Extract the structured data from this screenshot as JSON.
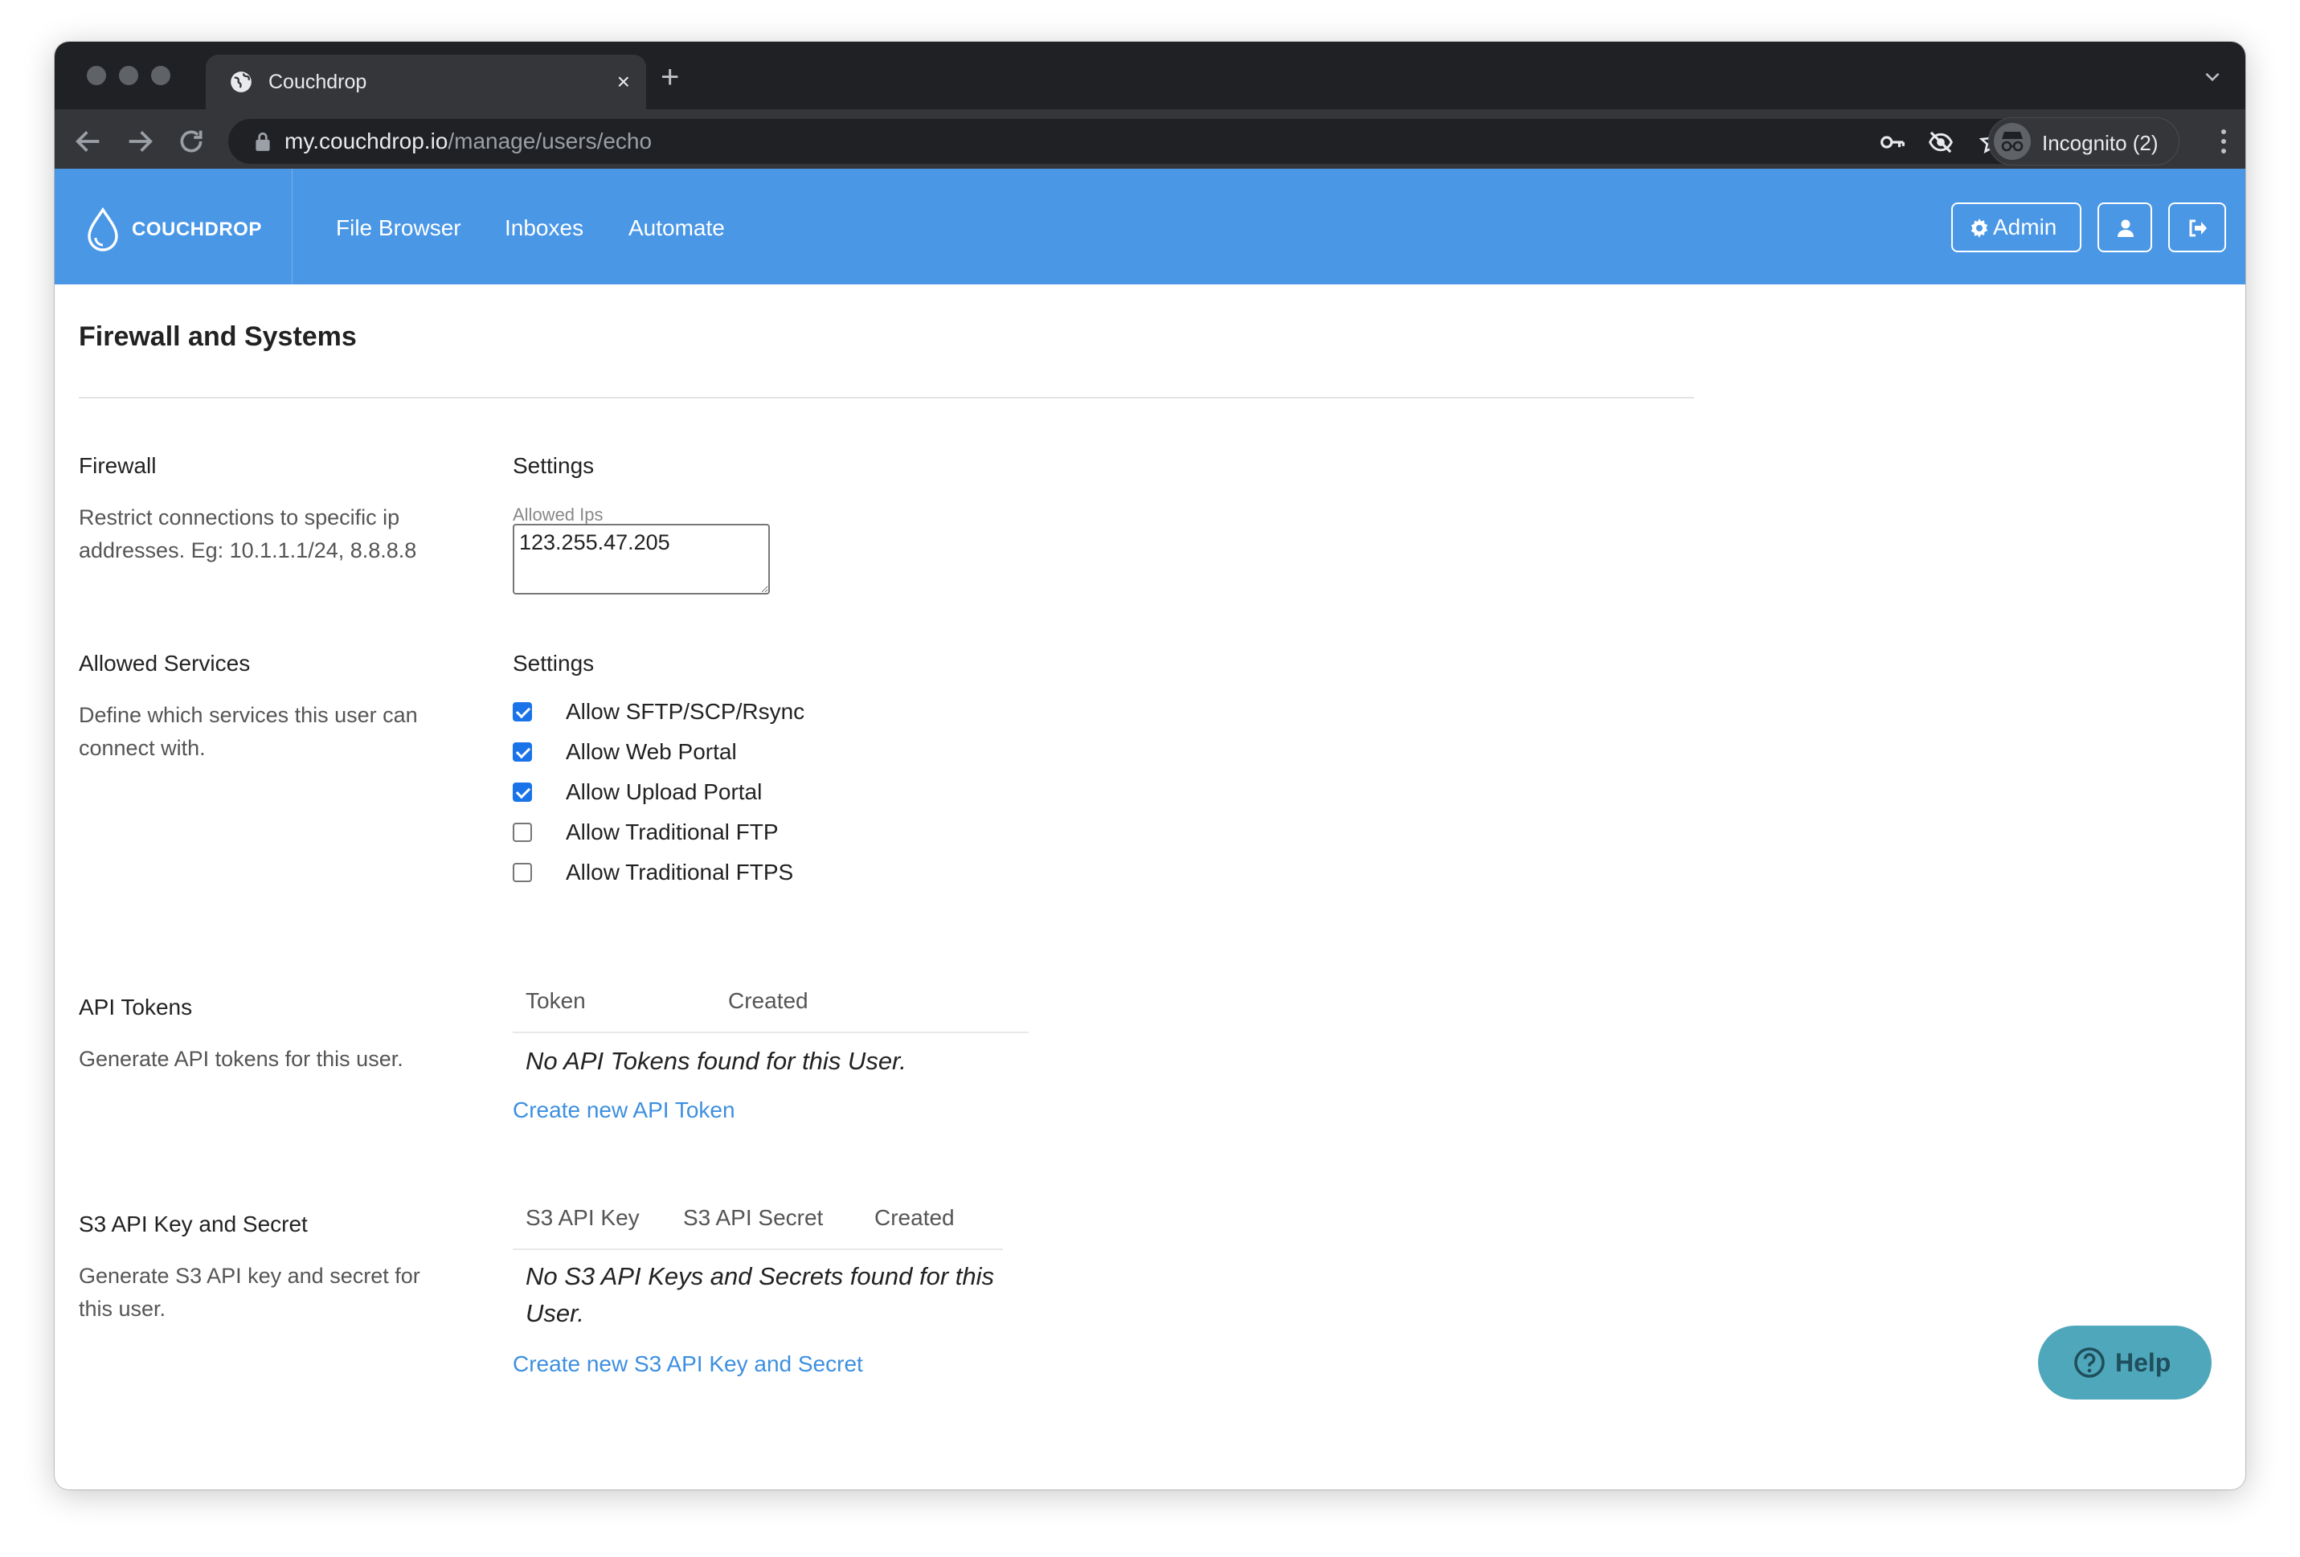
{
  "browser": {
    "tab_title": "Couchdrop",
    "tab_close": "×",
    "new_tab": "+",
    "url_host": "my.couchdrop.io",
    "url_path": "/manage/users/echo",
    "incognito_label": "Incognito (2)"
  },
  "header": {
    "brand": "COUCHDROP",
    "nav": [
      "File Browser",
      "Inboxes",
      "Automate"
    ],
    "admin_label": "Admin",
    "accent_color": "#4a97e6"
  },
  "page": {
    "title": "Firewall and Systems",
    "firewall": {
      "title": "Firewall",
      "description": "Restrict connections to specific ip addresses. Eg: 10.1.1.1/24, 8.8.8.8",
      "settings_label": "Settings",
      "field_label": "Allowed Ips",
      "field_value": "123.255.47.205"
    },
    "services": {
      "title": "Allowed Services",
      "description": "Define which services this user can connect with.",
      "settings_label": "Settings",
      "options": [
        {
          "label": "Allow SFTP/SCP/Rsync",
          "checked": true
        },
        {
          "label": "Allow Web Portal",
          "checked": true
        },
        {
          "label": "Allow Upload Portal",
          "checked": true
        },
        {
          "label": "Allow Traditional FTP",
          "checked": false
        },
        {
          "label": "Allow Traditional FTPS",
          "checked": false
        }
      ]
    },
    "api_tokens": {
      "title": "API Tokens",
      "description": "Generate API tokens for this user.",
      "columns": [
        "Token",
        "Created"
      ],
      "empty_message": "No API Tokens found for this User.",
      "create_link": "Create new API Token"
    },
    "s3": {
      "title": "S3 API Key and Secret",
      "description": "Generate S3 API key and secret for this user.",
      "columns": [
        "S3 API Key",
        "S3 API Secret",
        "Created"
      ],
      "empty_message": "No S3 API Keys and Secrets found for this User.",
      "create_link": "Create new S3 API Key and Secret"
    }
  },
  "help": {
    "label": "Help"
  }
}
